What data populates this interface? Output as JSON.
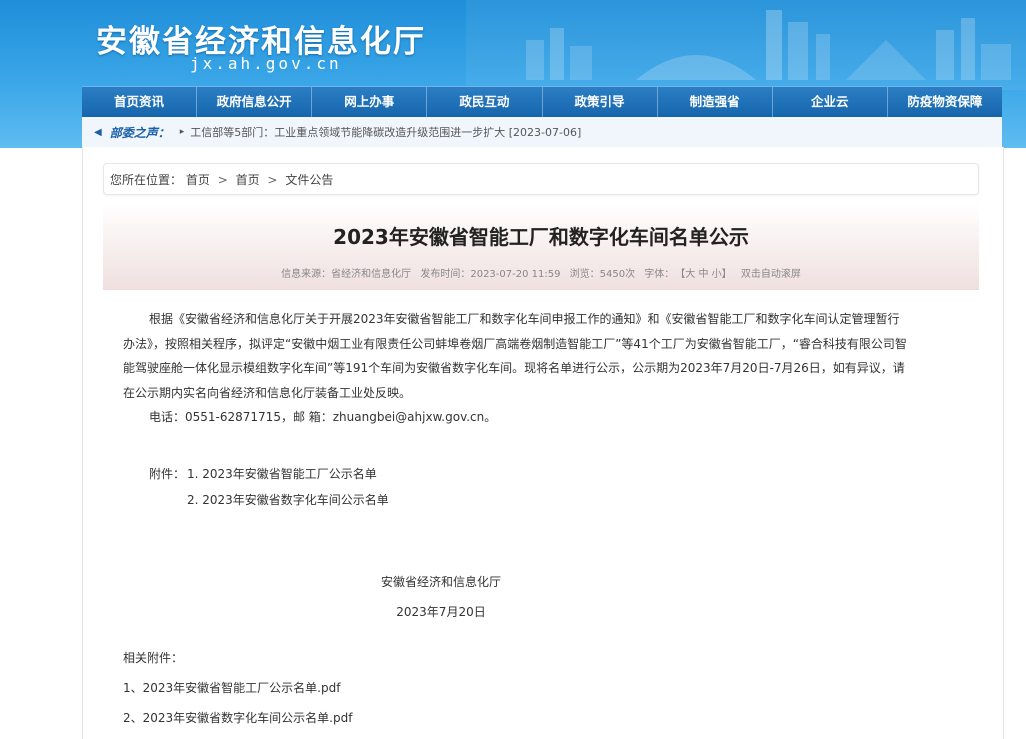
{
  "site": {
    "title": "安徽省经济和信息化厅",
    "domain": "jx.ah.gov.cn"
  },
  "nav": {
    "items": [
      "首页资讯",
      "政府信息公开",
      "网上办事",
      "政民互动",
      "政策引导",
      "制造强省",
      "企业云",
      "防疫物资保障"
    ]
  },
  "ticker": {
    "label": "部委之声：",
    "text": "工信部等5部门：工业重点领域节能降碳改造升级范围进一步扩大 [2023-07-06]"
  },
  "breadcrumb": {
    "prefix": "您所在位置：",
    "items": [
      "首页",
      "首页",
      "文件公告"
    ],
    "separator": ">"
  },
  "article": {
    "title": "2023年安徽省智能工厂和数字化车间名单公示",
    "meta": {
      "source": "信息来源：省经济和信息化厅",
      "time": "发布时间：2023-07-20 11:59",
      "views": "浏览：5450次",
      "font_label": "字体：",
      "font_sizes": "【大 中 小】",
      "autoscroll": "双击自动滚屏"
    },
    "lines": [
      "根据《安徽省经济和信息化厅关于开展2023年安徽省智能工厂和数字化车间申报工作的通知》和《安徽省智能工厂和数字化车间认定管理暂行",
      "办法》，按照相关程序，拟评定“安徽中烟工业有限责任公司蚌埠卷烟厂高端卷烟制造智能工厂”等41个工厂为安徽省智能工厂，“睿合科技有限公司智",
      "能驾驶座舱一体化显示模组数字化车间”等191个车间为安徽省数字化车间。现将名单进行公示，公示期为2023年7月20日-7月26日，如有异议，请",
      "在公示期内实名向省经济和信息化厅装备工业处反映。"
    ],
    "contact": "电话：0551-62871715，邮 箱：zhuangbei@ahjxw.gov.cn。",
    "attachments_label": "附件：",
    "attachments": [
      "1. 2023年安徽省智能工厂公示名单",
      "2. 2023年安徽省数字化车间公示名单"
    ],
    "signature_org": "安徽省经济和信息化厅",
    "signature_date": "2023年7月20日"
  },
  "related": {
    "label": "相关附件：",
    "files": [
      "1、2023年安徽省智能工厂公示名单.pdf",
      "2、2023年安徽省数字化车间公示名单.pdf"
    ]
  },
  "colors": {
    "banner": "#2a96de",
    "nav": "#1a6cb2",
    "accent": "#1a5fa8"
  }
}
